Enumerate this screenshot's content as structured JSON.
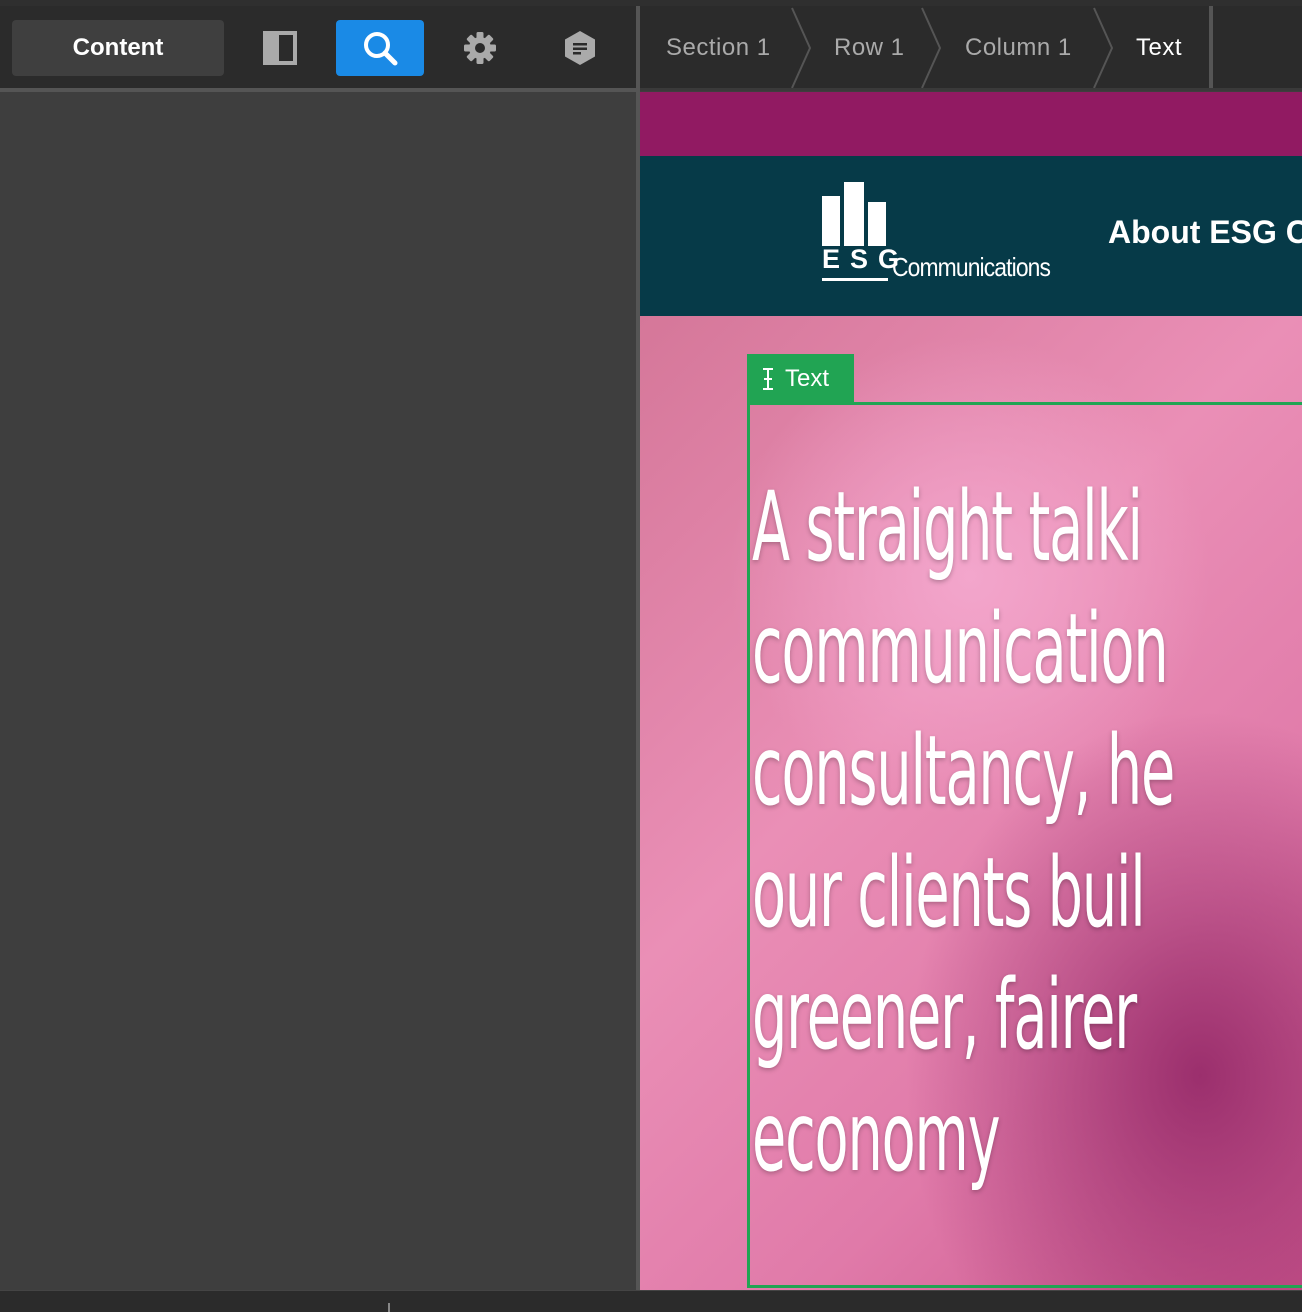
{
  "toolbar": {
    "content_label": "Content",
    "tools": [
      {
        "icon": "panel-layout-icon",
        "active": false
      },
      {
        "icon": "search-icon",
        "active": true
      },
      {
        "icon": "gear-icon",
        "active": false
      },
      {
        "icon": "note-hexagon-icon",
        "active": false
      }
    ]
  },
  "breadcrumb": {
    "items": [
      "Section 1",
      "Row 1",
      "Column 1",
      "Text"
    ]
  },
  "preview": {
    "logo_letters": "ESG",
    "logo_word": "Communications",
    "nav_item": "About ESG C",
    "selected_label": "Text",
    "hero_lines": [
      "A straight talki",
      "communication",
      "consultancy, he",
      "our clients buil",
      "greener, fairer",
      "economy"
    ]
  },
  "colors": {
    "accent": "#1a8ae6",
    "selection": "#21a453",
    "header_bg": "#063a48",
    "band_bg": "#911a62"
  }
}
